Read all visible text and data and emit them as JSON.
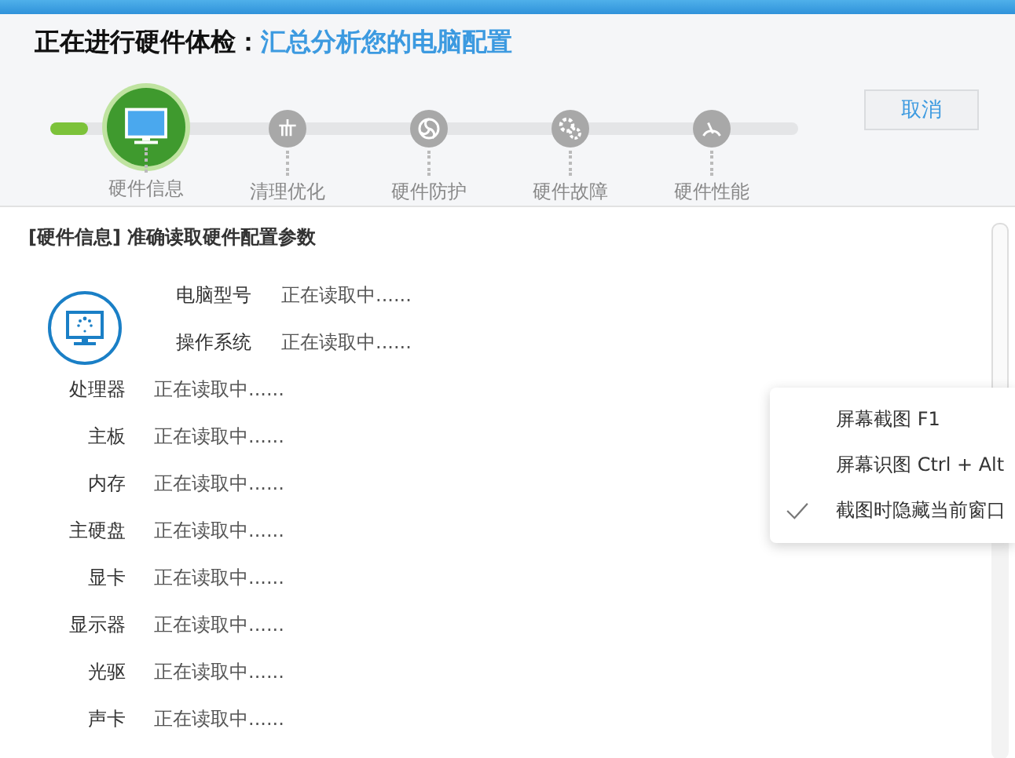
{
  "title": {
    "prefix": "正在进行硬件体检：",
    "highlight": "汇总分析您的电脑配置"
  },
  "steps": [
    {
      "label": "硬件信息",
      "selected": true
    },
    {
      "label": "清理优化",
      "selected": false
    },
    {
      "label": "硬件防护",
      "selected": false
    },
    {
      "label": "硬件故障",
      "selected": false
    },
    {
      "label": "硬件性能",
      "selected": false
    }
  ],
  "cancel_button": "取消",
  "section_title": "[硬件信息] 准确读取硬件配置参数",
  "summary_rows": [
    {
      "label": "电脑型号",
      "value": "正在读取中......"
    },
    {
      "label": "操作系统",
      "value": "正在读取中......"
    }
  ],
  "detail_rows": [
    {
      "label": "处理器",
      "value": "正在读取中......"
    },
    {
      "label": "主板",
      "value": "正在读取中......"
    },
    {
      "label": "内存",
      "value": "正在读取中......"
    },
    {
      "label": "主硬盘",
      "value": "正在读取中......"
    },
    {
      "label": "显卡",
      "value": "正在读取中......"
    },
    {
      "label": "显示器",
      "value": "正在读取中......"
    },
    {
      "label": "光驱",
      "value": "正在读取中......"
    },
    {
      "label": "声卡",
      "value": "正在读取中......"
    }
  ],
  "context_menu": [
    {
      "label": "屏幕截图 F1",
      "checked": false
    },
    {
      "label": "屏幕识图 Ctrl + Alt",
      "checked": false
    },
    {
      "label": "截图时隐藏当前窗口",
      "checked": true
    }
  ]
}
